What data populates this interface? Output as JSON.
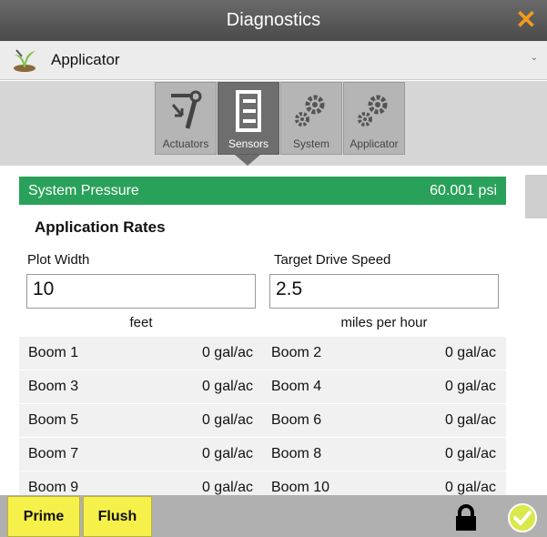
{
  "window": {
    "title": "Diagnostics",
    "close_icon": "close-icon"
  },
  "dropdown": {
    "selected": "Applicator",
    "icon": "plant-icon"
  },
  "tabs": [
    {
      "label": "Actuators",
      "icon": "actuator-icon",
      "active": false
    },
    {
      "label": "Sensors",
      "icon": "sensors-icon",
      "active": true
    },
    {
      "label": "System",
      "icon": "gears-icon",
      "active": false
    },
    {
      "label": "Applicator",
      "icon": "gears-icon",
      "active": false
    }
  ],
  "pressure": {
    "label": "System Pressure",
    "value": "60.001 psi",
    "color": "#2aa15a"
  },
  "rates": {
    "title": "Application Rates",
    "plot_width": {
      "label": "Plot Width",
      "value": "10",
      "unit": "feet"
    },
    "target_speed": {
      "label": "Target Drive Speed",
      "value": "2.5",
      "unit": "miles per hour"
    }
  },
  "booms": [
    {
      "name": "Boom 1",
      "value": "0 gal/ac"
    },
    {
      "name": "Boom 2",
      "value": "0 gal/ac"
    },
    {
      "name": "Boom 3",
      "value": "0 gal/ac"
    },
    {
      "name": "Boom 4",
      "value": "0 gal/ac"
    },
    {
      "name": "Boom 5",
      "value": "0 gal/ac"
    },
    {
      "name": "Boom 6",
      "value": "0 gal/ac"
    },
    {
      "name": "Boom 7",
      "value": "0 gal/ac"
    },
    {
      "name": "Boom 8",
      "value": "0 gal/ac"
    },
    {
      "name": "Boom 9",
      "value": "0 gal/ac"
    },
    {
      "name": "Boom 10",
      "value": "0 gal/ac"
    }
  ],
  "footer": {
    "prime_label": "Prime",
    "flush_label": "Flush",
    "lock_icon": "lock-icon",
    "confirm_icon": "checkmark-icon",
    "accent": "#f6f04a"
  }
}
